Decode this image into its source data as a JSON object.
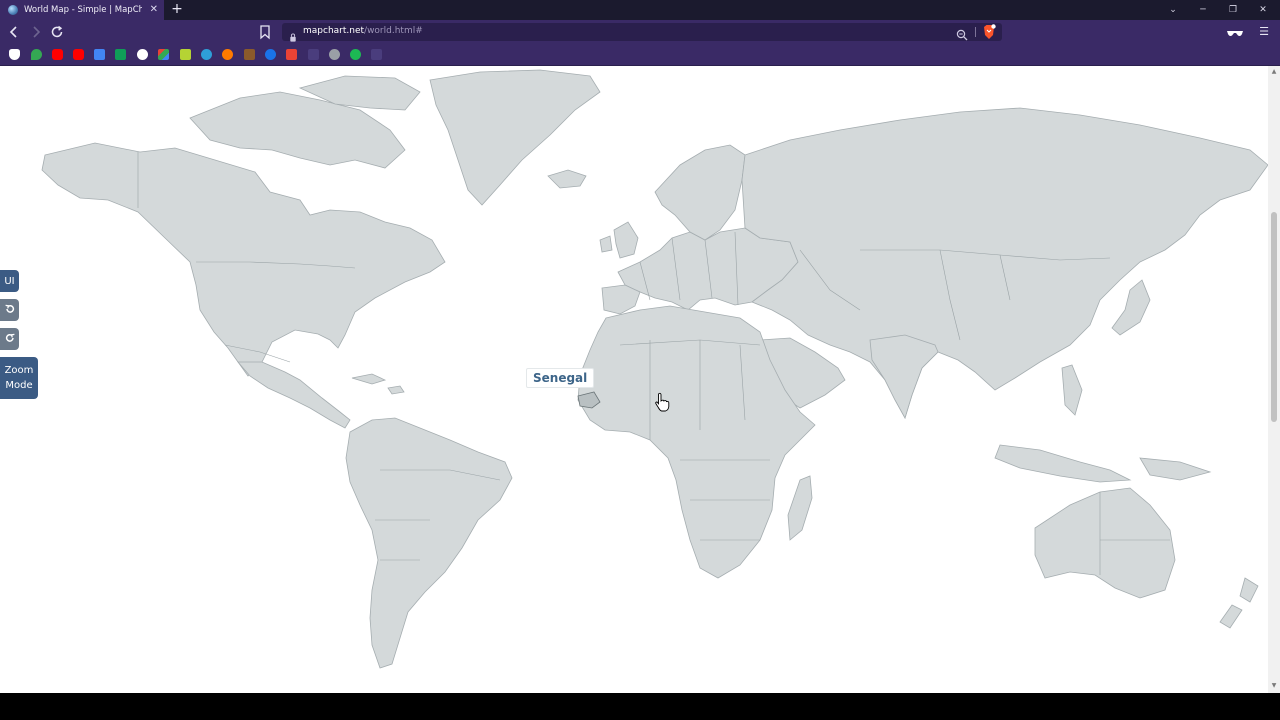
{
  "browser": {
    "tab_title": "World Map - Simple | MapChart",
    "new_tab_symbol": "+",
    "url_host": "mapchart.net",
    "url_path": "/world.html#"
  },
  "map": {
    "hovered_country": "Senegal"
  },
  "controls": {
    "ui_button": "UI",
    "zoom_mode_line1": "Zoom",
    "zoom_mode_line2": "Mode"
  },
  "icons": {
    "favicon": "globe-icon",
    "back": "arrow-left-icon",
    "forward": "arrow-right-icon",
    "reload": "reload-icon",
    "bookmark": "bookmark-icon",
    "lock": "lock-icon",
    "zoom": "magnifier-icon",
    "brave_shields": "lion-shield-icon",
    "extension": "sunglasses-icon",
    "menu": "hamburger-menu-icon",
    "undo": "undo-icon",
    "redo": "redo-icon",
    "cursor": "hand-pointer-icon"
  },
  "colors": {
    "chrome_bg": "#3a2a66",
    "tabstrip_bg": "#1b1a2e",
    "land": "#d4d9da",
    "land_stroke": "#a5adb0",
    "tooltip_text": "#3d6589",
    "side_button": "#3b5b84"
  }
}
